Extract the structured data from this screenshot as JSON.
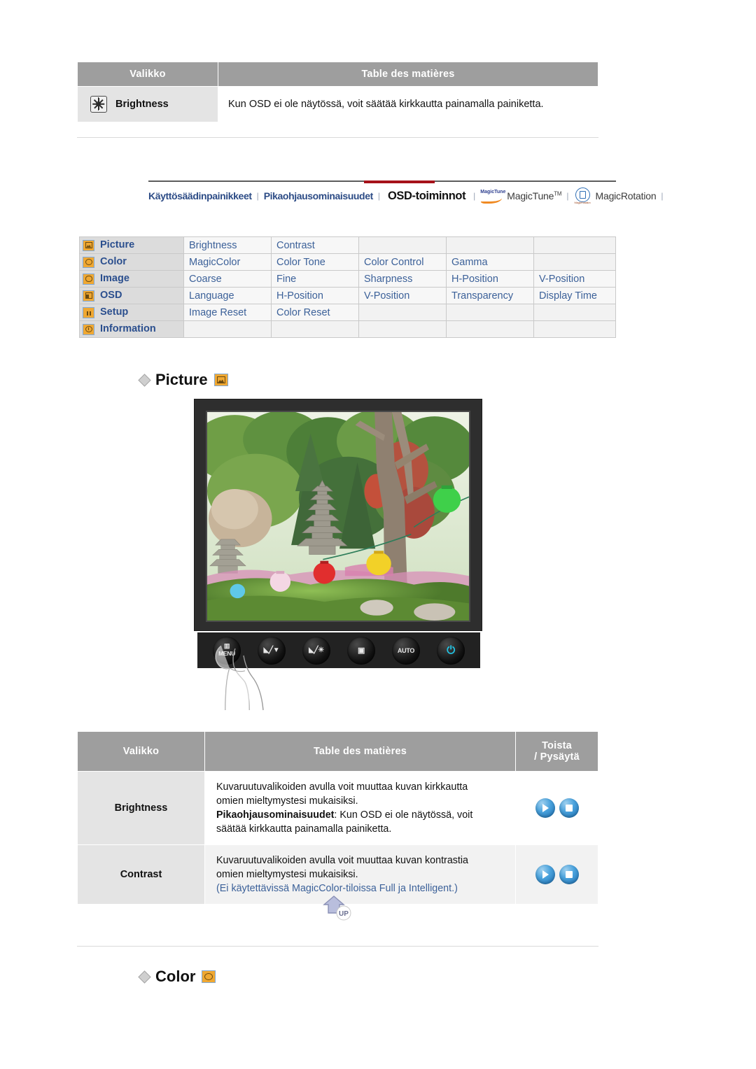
{
  "top_table": {
    "headers": [
      "Valikko",
      "Table des matières"
    ],
    "rows": [
      {
        "icon": "brightness-sun-icon",
        "menu": "Brightness",
        "desc": "Kun OSD ei ole näytössä, voit säätää kirkkautta painamalla painiketta."
      }
    ]
  },
  "navbar": {
    "items": [
      {
        "label": "Käyttösäädinpainikkeet",
        "style": "link"
      },
      {
        "label": "|",
        "style": "sep"
      },
      {
        "label": "Pikaohjausominaisuudet",
        "style": "link"
      },
      {
        "label": "|",
        "style": "sep"
      },
      {
        "label": "OSD-toiminnot",
        "style": "active"
      },
      {
        "label": "|",
        "style": "sep"
      },
      {
        "label": "MagicTune",
        "style": "plain",
        "icon": "magictune-logo-icon",
        "sup": "TM"
      },
      {
        "label": "|",
        "style": "sep"
      },
      {
        "label": "MagicRotation",
        "style": "plain",
        "icon": "magicrotation-logo-icon"
      },
      {
        "label": "|",
        "style": "sep"
      }
    ]
  },
  "menu_table": {
    "rows": [
      {
        "icon": "picture-icon",
        "group": "Picture",
        "items": [
          "Brightness",
          "Contrast",
          "",
          "",
          ""
        ]
      },
      {
        "icon": "color-icon",
        "group": "Color",
        "items": [
          "MagicColor",
          "Color Tone",
          "Color Control",
          "Gamma",
          ""
        ]
      },
      {
        "icon": "image-icon",
        "group": "Image",
        "items": [
          "Coarse",
          "Fine",
          "Sharpness",
          "H-Position",
          "V-Position"
        ]
      },
      {
        "icon": "osd-icon",
        "group": "OSD",
        "items": [
          "Language",
          "H-Position",
          "V-Position",
          "Transparency",
          "Display Time"
        ]
      },
      {
        "icon": "setup-icon",
        "group": "Setup",
        "items": [
          "Image Reset",
          "Color Reset",
          "",
          "",
          ""
        ]
      },
      {
        "icon": "information-icon",
        "group": "Information",
        "items": [
          "",
          "",
          "",
          "",
          ""
        ]
      }
    ]
  },
  "picture_section": {
    "title": "Picture",
    "icon": "picture-icon"
  },
  "monitor": {
    "buttons": [
      {
        "name": "menu-button",
        "label": "MENU",
        "glyph": "▥"
      },
      {
        "name": "down-up-button",
        "label": "",
        "glyph": "◣╱▼"
      },
      {
        "name": "brightness-button",
        "label": "",
        "glyph": "◣╱☀"
      },
      {
        "name": "enter-button",
        "label": "",
        "glyph": "▣"
      },
      {
        "name": "auto-button",
        "label": "AUTO",
        "glyph": ""
      },
      {
        "name": "power-button",
        "label": "",
        "glyph": "⏻"
      }
    ]
  },
  "detail_table": {
    "headers": [
      "Valikko",
      "Table des matières",
      "Toista\n/ Pysäytä"
    ],
    "header_toista_line1": "Toista",
    "header_toista_line2": "/ Pysäytä",
    "rows": [
      {
        "menu": "Brightness",
        "desc_line1": "Kuvaruutuvalikoiden avulla voit muuttaa kuvan kirkkautta",
        "desc_line2": "omien mieltymystesi mukaisiksi.",
        "desc_bold": "Pikaohjausominaisuudet",
        "desc_line3": ": Kun OSD ei ole näytössä, voit",
        "desc_line4": "säätää kirkkautta painamalla painiketta.",
        "desc_note": "",
        "buttons": [
          "play-button",
          "stop-button"
        ]
      },
      {
        "menu": "Contrast",
        "desc_line1": "Kuvaruutuvalikoiden avulla voit muuttaa kuvan kontrastia",
        "desc_line2": "omien mieltymystesi mukaisiksi.",
        "desc_bold": "",
        "desc_line3": "",
        "desc_line4": "",
        "desc_note": "(Ei käytettävissä MagicColor-tiloissa Full ja Intelligent.)",
        "buttons": [
          "play-button",
          "stop-button"
        ]
      }
    ]
  },
  "up_button": {
    "label": "UP"
  },
  "color_section": {
    "title": "Color",
    "icon": "color-icon"
  },
  "colors": {
    "header_grey": "#9e9e9e",
    "menu_cell": "#e4e4e4",
    "link_blue": "#3c6199",
    "nav_blue": "#2d4c86",
    "accent_red": "#a6121a",
    "icon_orange": "#f0a832"
  }
}
